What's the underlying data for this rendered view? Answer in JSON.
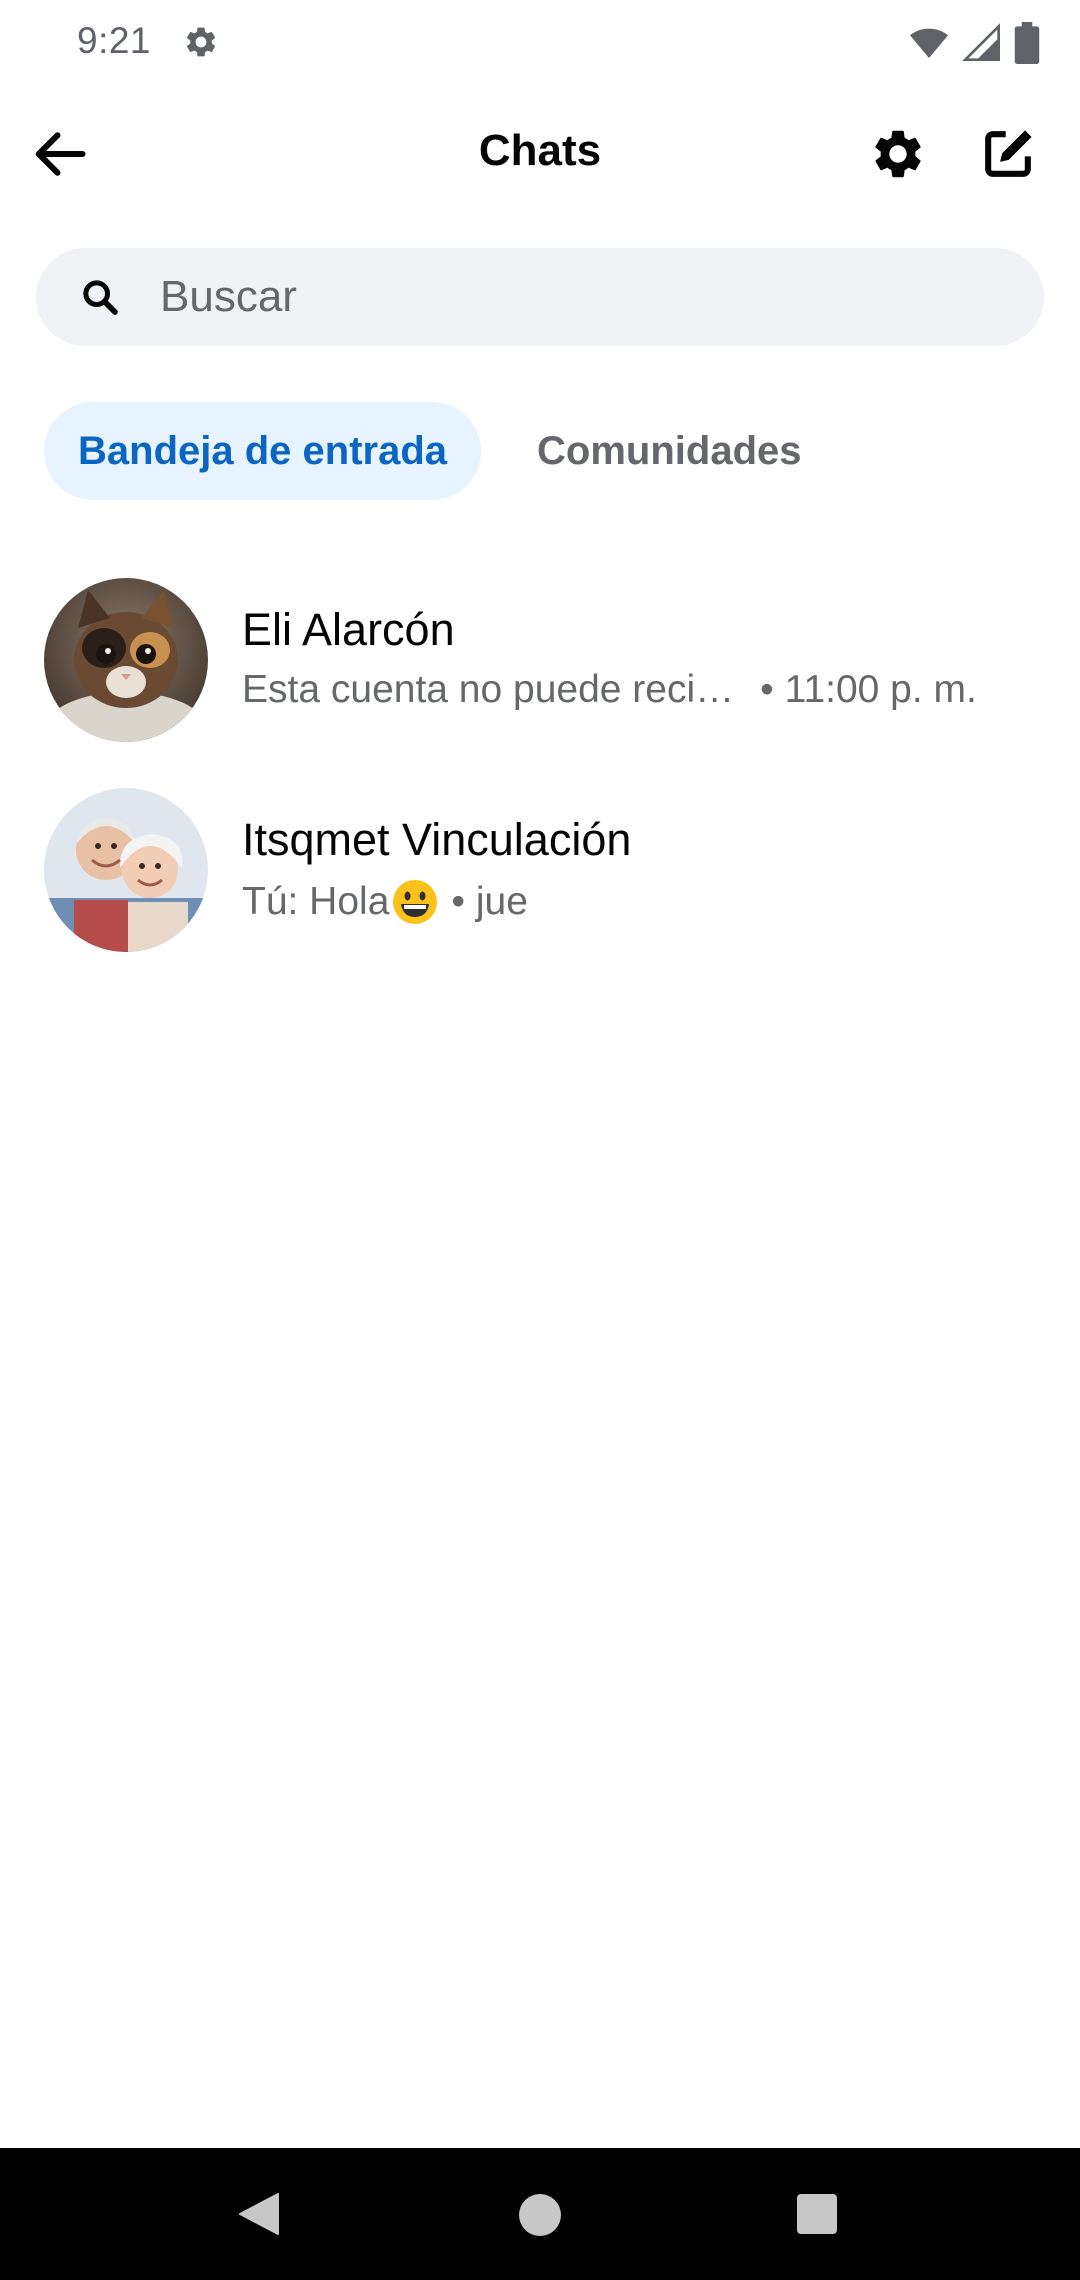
{
  "status_bar": {
    "time": "9:21",
    "icons": [
      "settings-gear-icon",
      "wifi-icon",
      "cell-signal-icon",
      "battery-icon"
    ]
  },
  "app_bar": {
    "title": "Chats",
    "back_icon": "arrow-back-icon",
    "settings_icon": "gear-icon",
    "compose_icon": "compose-edit-icon"
  },
  "search": {
    "placeholder": "Buscar",
    "value": ""
  },
  "tabs": [
    {
      "label": "Bandeja de entrada",
      "active": true
    },
    {
      "label": "Comunidades",
      "active": false
    }
  ],
  "chats": [
    {
      "name": "Eli Alarcón",
      "snippet": "Esta cuenta no puede reci…",
      "time": "• 11:00 p. m.",
      "avatar": "cat-photo"
    },
    {
      "name": "Itsqmet Vinculación",
      "snippet": "Tú: Hola",
      "emoji": "grinning-face-emoji",
      "time": "• jue",
      "avatar": "elderly-couple-photo"
    }
  ],
  "nav_bar": {
    "icons": [
      "nav-back-icon",
      "nav-home-icon",
      "nav-recents-icon"
    ]
  },
  "colors": {
    "accent": "#0a66c2",
    "accent_bg": "#e7f3ff",
    "search_bg": "#f0f2f5",
    "secondary_text": "#65676b"
  }
}
